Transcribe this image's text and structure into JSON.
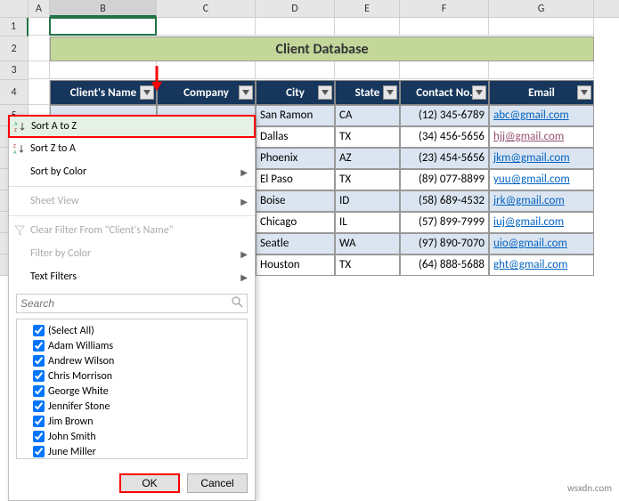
{
  "columns": [
    "A",
    "B",
    "C",
    "D",
    "E",
    "F",
    "G"
  ],
  "title": "Client Database",
  "headers": {
    "name": "Client's Name",
    "company": "Company",
    "city": "City",
    "state": "State",
    "contact": "Contact No.",
    "email": "Email"
  },
  "rows": [
    {
      "city": "San Ramon",
      "state": "CA",
      "contact": "(12) 345-6789",
      "email": "abc@gmail.com",
      "pink": false
    },
    {
      "city": "Dallas",
      "state": "TX",
      "contact": "(34) 456-5656",
      "email": "hjj@gmail.com",
      "pink": true
    },
    {
      "city": "Phoenix",
      "state": "AZ",
      "contact": "(23) 454-5656",
      "email": "jkm@gmail.com",
      "pink": false
    },
    {
      "city": "El Paso",
      "state": "TX",
      "contact": "(89) 077-8899",
      "email": "yuu@gmail.com",
      "pink": false
    },
    {
      "city": "Boise",
      "state": "ID",
      "contact": "(58) 689-4532",
      "email": "jrk@gmail.com",
      "pink": false
    },
    {
      "city": "Chicago",
      "state": "IL",
      "contact": "(57) 899-7999",
      "email": "iuj@gmail.com",
      "pink": false
    },
    {
      "city": "Seatle",
      "state": "WA",
      "contact": "(97) 890-7070",
      "email": "uio@gmail.com",
      "pink": false
    },
    {
      "city": "Houston",
      "state": "TX",
      "contact": "(64) 888-5688",
      "email": "ght@gmail.com",
      "pink": false
    }
  ],
  "menu": {
    "sort_az": "Sort A to Z",
    "sort_za": "Sort Z to A",
    "sort_color": "Sort by Color",
    "sheet_view": "Sheet View",
    "clear_filter": "Clear Filter From \"Client's Name\"",
    "filter_color": "Filter by Color",
    "text_filters": "Text Filters",
    "search_placeholder": "Search",
    "ok": "OK",
    "cancel": "Cancel",
    "items": [
      "(Select All)",
      "Adam Williams",
      "Andrew Wilson",
      "Chris Morrison",
      "George White",
      "Jennifer Stone",
      "Jim Brown",
      "John Smith",
      "June Miller"
    ]
  },
  "watermark": "wsxdn.com",
  "chart_data": {
    "type": "table",
    "title": "Client Database",
    "columns": [
      "Client's Name",
      "Company",
      "City",
      "State",
      "Contact No.",
      "Email"
    ],
    "rows_visible_partial": [
      {
        "City": "San Ramon",
        "State": "CA",
        "Contact No.": "(12) 345-6789",
        "Email": "abc@gmail.com"
      },
      {
        "City": "Dallas",
        "State": "TX",
        "Contact No.": "(34) 456-5656",
        "Email": "hjj@gmail.com"
      },
      {
        "City": "Phoenix",
        "State": "AZ",
        "Contact No.": "(23) 454-5656",
        "Email": "jkm@gmail.com"
      },
      {
        "City": "El Paso",
        "State": "TX",
        "Contact No.": "(89) 077-8899",
        "Email": "yuu@gmail.com"
      },
      {
        "City": "Boise",
        "State": "ID",
        "Contact No.": "(58) 689-4532",
        "Email": "jrk@gmail.com"
      },
      {
        "City": "Chicago",
        "State": "IL",
        "Contact No.": "(57) 899-7999",
        "Email": "iuj@gmail.com"
      },
      {
        "City": "Seatle",
        "State": "WA",
        "Contact No.": "(97) 890-7070",
        "Email": "uio@gmail.com"
      },
      {
        "City": "Houston",
        "State": "TX",
        "Contact No.": "(64) 888-5688",
        "Email": "ght@gmail.com"
      }
    ],
    "filter_values_client_name": [
      "Adam Williams",
      "Andrew Wilson",
      "Chris Morrison",
      "George White",
      "Jennifer Stone",
      "Jim Brown",
      "John Smith",
      "June Miller"
    ]
  }
}
